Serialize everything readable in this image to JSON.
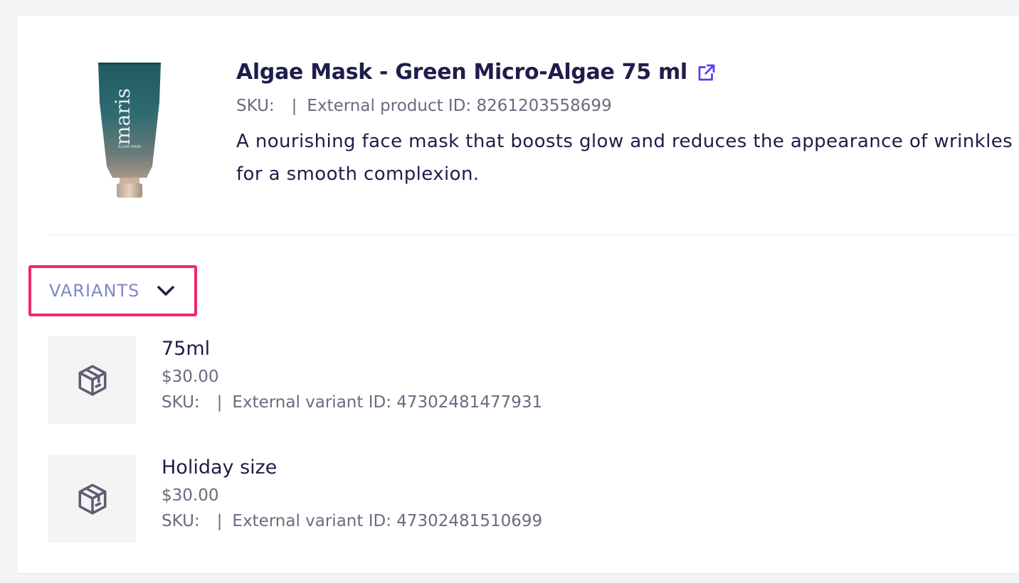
{
  "product": {
    "title": "Algae Mask - Green Micro-Algae 75 ml",
    "sku_label": "SKU:",
    "external_id_label": "External product ID: 8261203558699",
    "description": "A nourishing face mask that boosts glow and reduces the appearance of wrinkles for a smooth complexion.",
    "image_brand": "maris",
    "image_caption": "ALGAE MASK"
  },
  "variants_section": {
    "label": "VARIANTS"
  },
  "variants": [
    {
      "name": "75ml",
      "price": "$30.00",
      "sku_label": "SKU:",
      "external_id_label": "External variant ID: 47302481477931"
    },
    {
      "name": "Holiday size",
      "price": "$30.00",
      "sku_label": "SKU:",
      "external_id_label": "External variant ID: 47302481510699"
    }
  ],
  "colors": {
    "highlight": "#f0286f",
    "link": "#5b3df5",
    "variants_label": "#7f86c9",
    "title": "#1f1d4a"
  },
  "icons": {
    "external_link": "external-link-icon",
    "chevron": "chevron-down-icon",
    "variant_thumb": "package-box-icon"
  }
}
